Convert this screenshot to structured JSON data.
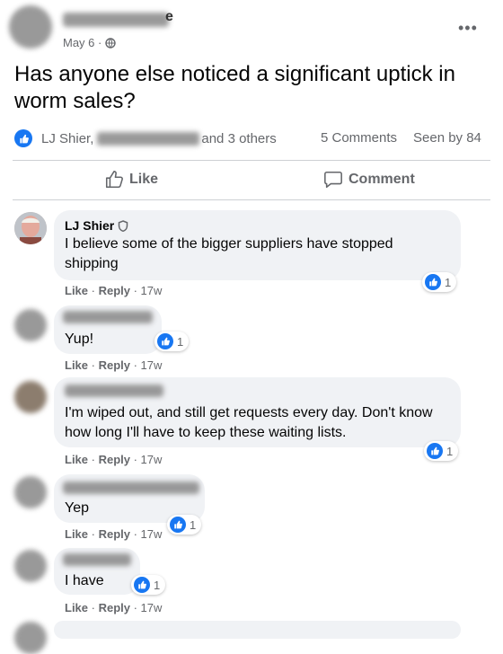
{
  "post": {
    "date": "May 6 ·",
    "text": "Has anyone else noticed a significant uptick in worm sales?",
    "reaction_name": "LJ Shier,",
    "reaction_others": "and 3 others",
    "comments_count": "5 Comments",
    "seen_by": "Seen by 84"
  },
  "actions": {
    "like": "Like",
    "comment": "Comment"
  },
  "comments": [
    {
      "name": "LJ Shier",
      "text": "I believe some of the bigger suppliers have stopped shipping",
      "reactions": "1"
    },
    {
      "text": "Yup!",
      "reactions": "1"
    },
    {
      "text": "I'm wiped out, and still get requests every day. Don't know how long I'll have to keep these waiting lists.",
      "reactions": "1"
    },
    {
      "text": "Yep",
      "reactions": "1"
    },
    {
      "text": "I have",
      "reactions": "1"
    }
  ],
  "meta": {
    "like": "Like",
    "reply": "Reply",
    "time": "17w"
  },
  "colors": {
    "accent": "#1877f2",
    "bubble": "#f0f2f5",
    "muted": "#65676b"
  }
}
